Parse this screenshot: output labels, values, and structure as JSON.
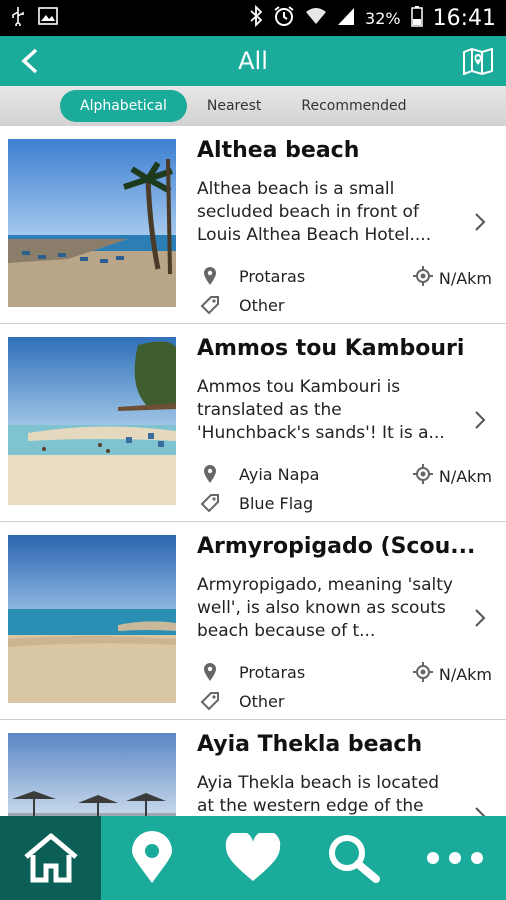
{
  "status_bar": {
    "battery": "32%",
    "time": "16:41"
  },
  "app_bar": {
    "title": "All"
  },
  "sort_tabs": [
    {
      "label": "Alphabetical",
      "active": true
    },
    {
      "label": "Nearest",
      "active": false
    },
    {
      "label": "Recommended",
      "active": false
    }
  ],
  "items": [
    {
      "title": "Althea beach",
      "description": "Althea beach is a small secluded beach in front of Louis Althea Beach Hotel....",
      "location": "Protaras",
      "category": "Other",
      "distance": "N/Akm"
    },
    {
      "title": "Ammos tou Kambouri",
      "description": "Ammos tou Kambouri is translated as the 'Hunchback's sands'! It is a...",
      "location": "Ayia Napa",
      "category": "Blue Flag",
      "distance": "N/Akm"
    },
    {
      "title": "Armyropigado (Scou...",
      "description": "Armyropigado, meaning 'salty well', is also known as scouts beach because of t...",
      "location": "Protaras",
      "category": "Other",
      "distance": "N/Akm"
    },
    {
      "title": "Ayia Thekla beach",
      "description": "Ayia Thekla beach is located at the western edge of the",
      "location": "",
      "category": "",
      "distance": ""
    }
  ],
  "colors": {
    "accent": "#1aab9b",
    "accent_dark": "#0c5f56"
  },
  "bottom_nav": [
    {
      "icon": "home-icon",
      "active": true
    },
    {
      "icon": "map-pin-icon",
      "active": false
    },
    {
      "icon": "heart-icon",
      "active": false
    },
    {
      "icon": "search-icon",
      "active": false
    },
    {
      "icon": "more-icon",
      "active": false
    }
  ]
}
